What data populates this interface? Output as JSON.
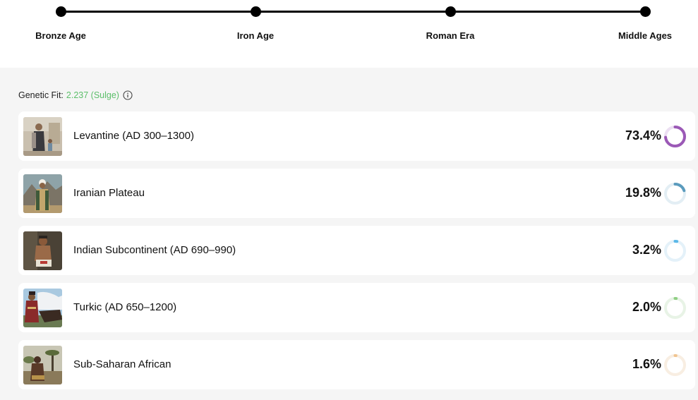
{
  "timeline": {
    "stops": [
      {
        "label": "Bronze Age"
      },
      {
        "label": "Iron Age"
      },
      {
        "label": "Roman Era"
      },
      {
        "label": "Middle Ages"
      }
    ]
  },
  "fit": {
    "label": "Genetic Fit:",
    "value": "2.237 (Sulge)"
  },
  "ancestry": [
    {
      "name": "Levantine (AD 300–1300)",
      "percent_label": "73.4%",
      "percent": 73.4,
      "color": "#9b59b6",
      "track": "#ecdff2"
    },
    {
      "name": "Iranian Plateau",
      "percent_label": "19.8%",
      "percent": 19.8,
      "color": "#5b9bbd",
      "track": "#e3eef4"
    },
    {
      "name": "Indian Subcontinent (AD 690–990)",
      "percent_label": "3.2%",
      "percent": 3.2,
      "color": "#5bb8e8",
      "track": "#e4f1f9"
    },
    {
      "name": "Turkic (AD 650–1200)",
      "percent_label": "2.0%",
      "percent": 2.0,
      "color": "#8fcf83",
      "track": "#e8f3e6"
    },
    {
      "name": "Sub-Saharan African",
      "percent_label": "1.6%",
      "percent": 1.6,
      "color": "#f0c48f",
      "track": "#f8eee2"
    }
  ]
}
